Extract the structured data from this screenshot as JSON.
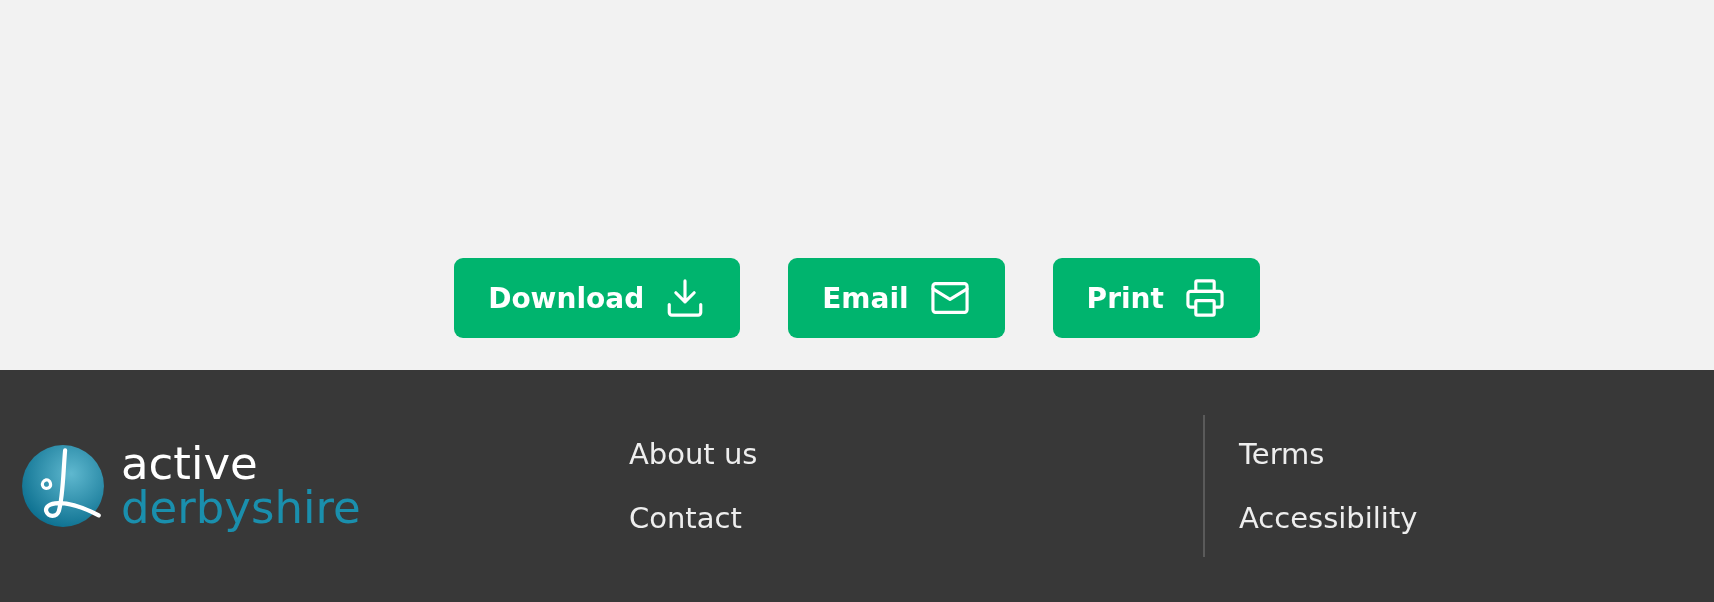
{
  "actions": [
    {
      "label": "Download",
      "kind": "download"
    },
    {
      "label": "Email",
      "kind": "email"
    },
    {
      "label": "Print",
      "kind": "print"
    }
  ],
  "footer": {
    "logo": {
      "line_1": "active",
      "line_2": "derbyshire"
    },
    "link_groups": [
      [
        "About us",
        "Contact"
      ],
      [
        "Terms",
        "Accessibility"
      ]
    ]
  }
}
